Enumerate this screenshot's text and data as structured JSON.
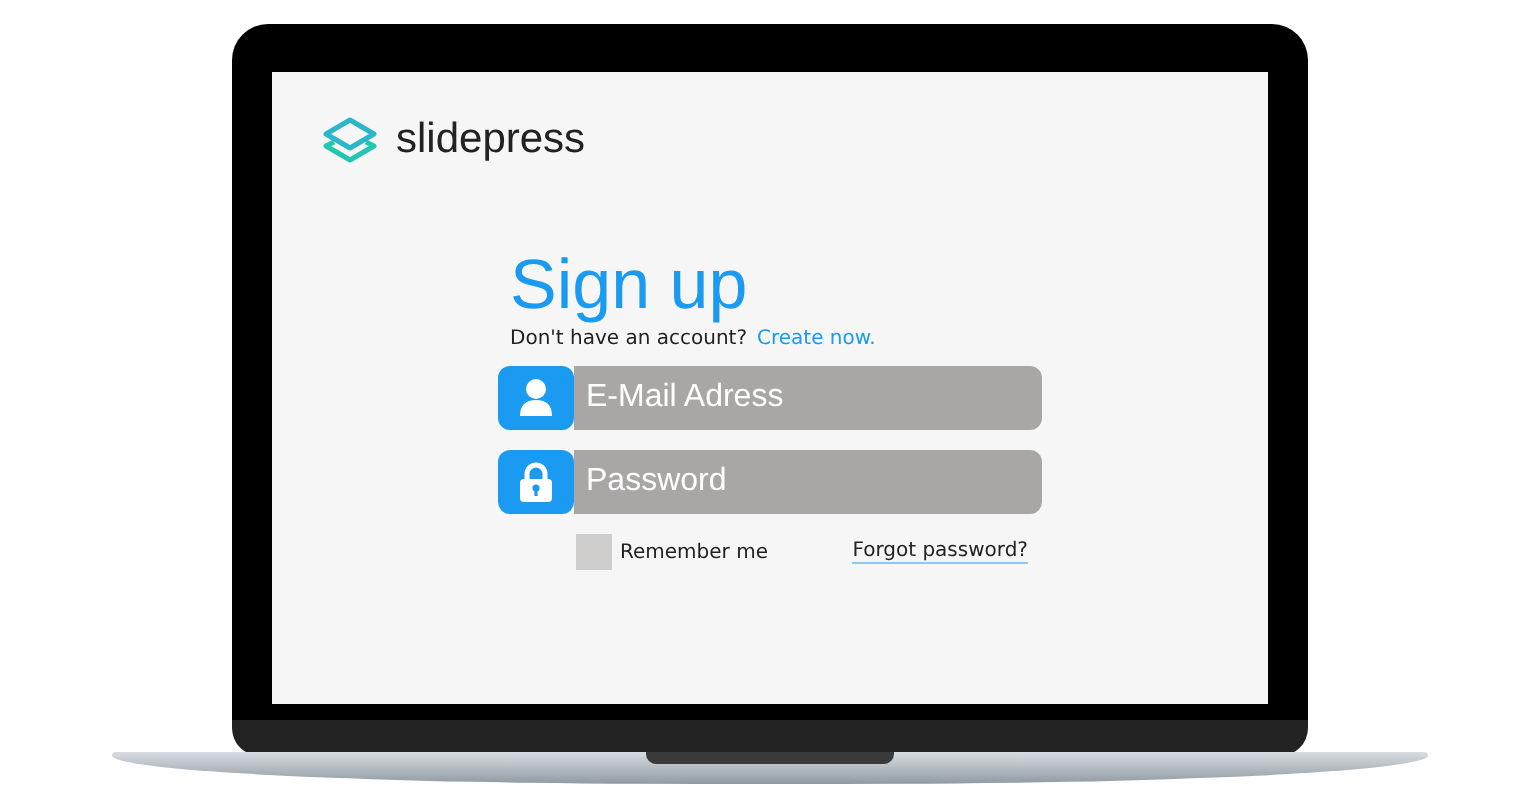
{
  "logo": {
    "text": "slidepress"
  },
  "form": {
    "title": "Sign up",
    "prompt": "Don't have an account?",
    "link": "Create now.",
    "fields": [
      {
        "kind": "user",
        "placeholder": "E-Mail Adress"
      },
      {
        "kind": "lock",
        "placeholder": "Password"
      }
    ],
    "remember": {
      "label": "Remember me",
      "checked": false
    },
    "forgot": "Forgot password?"
  }
}
